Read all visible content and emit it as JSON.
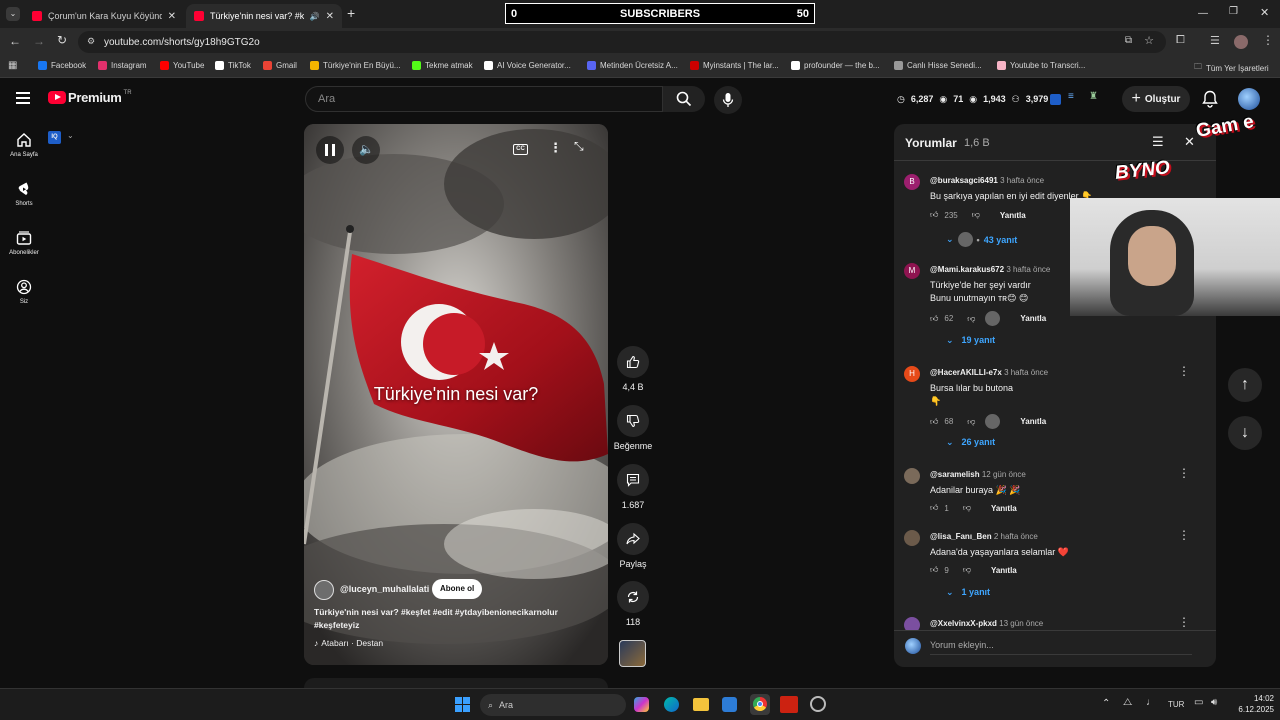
{
  "browser": {
    "tabs": [
      {
        "title": "Çorum'un Kara Kuyu Köyünde"
      },
      {
        "title": "Türkiye'nin nesi var? #keşfe"
      }
    ],
    "new_tab": "+",
    "url": "youtube.com/shorts/gy18h9GTG2o",
    "bookmarks": [
      {
        "label": "Facebook",
        "color": "#1877f2"
      },
      {
        "label": "Instagram",
        "color": "#e1306c"
      },
      {
        "label": "YouTube",
        "color": "#ff0000"
      },
      {
        "label": "TikTok",
        "color": "#ffffff"
      },
      {
        "label": "Gmail",
        "color": "#ea4335"
      },
      {
        "label": "Türkiye'nin En Büyü...",
        "color": "#f4b400"
      },
      {
        "label": "Tekme atmak",
        "color": "#53fc18"
      },
      {
        "label": "AI Voice Generator...",
        "color": "#ffffff"
      },
      {
        "label": "Metinden Ücretsiz A...",
        "color": "#5865f2"
      },
      {
        "label": "Myinstants | The lar...",
        "color": "#c00"
      },
      {
        "label": "profounder — the b...",
        "color": "#ffffff"
      },
      {
        "label": "Canlı Hisse Senedi...",
        "color": "#999"
      },
      {
        "label": "Youtube to Transcri...",
        "color": "#f7b4c6"
      }
    ],
    "all_bookmarks": "Tüm Yer İşaretleri"
  },
  "overlay": {
    "subscribers_label": "SUBSCRIBERS",
    "subscribers_left": "0",
    "subscribers_right": "50",
    "stream_logo": "BYNO",
    "stream_logo2": "Gam e"
  },
  "youtube": {
    "logo": "Premium",
    "logo_region": "TR",
    "search_placeholder": "Ara",
    "nav": [
      {
        "label": "Ana Sayfa",
        "icon": "home-icon"
      },
      {
        "label": "Shorts",
        "icon": "shorts-icon"
      },
      {
        "label": "Abonelikler",
        "icon": "subscriptions-icon"
      },
      {
        "label": "Siz",
        "icon": "account-icon"
      }
    ],
    "stats": [
      "6,287",
      "71",
      "1,943",
      "3,979"
    ],
    "create_label": "Oluştur",
    "short": {
      "overlay_title": "Türkiye'nin nesi var?",
      "channel": "@luceyn_muhallalati",
      "subscribe": "Abone ol",
      "description_line1": "Türkiye'nin nesi var? #keşfet #edit #ytdayibenionecikarnolur",
      "description_line2": "#keşfeteyiz",
      "sound": "Atabarı · Destan",
      "likes": "4,4 B",
      "dislike_label": "Beğenme",
      "comments_count": "1.687",
      "share_label": "Paylaş",
      "remix_count": "118"
    },
    "comments_panel": {
      "title": "Yorumlar",
      "count": "1,6 B",
      "input_placeholder": "Yorum ekleyin...",
      "reply_label": "Yanıtla",
      "items": [
        {
          "avatar_letter": "B",
          "avatar_color": "#9c1f6e",
          "user": "@buraksagci6491",
          "time": "3 hafta önce",
          "text": "Bu şarkıya yapılan en iyi edit diyenler 👇",
          "likes": "235",
          "replies": "43 yanıt"
        },
        {
          "avatar_letter": "M",
          "avatar_color": "#8e1450",
          "user": "@Mami.karakus672",
          "time": "3 hafta önce",
          "text": "Türkiye'de her şeyi vardır\nBunu unutmayın ᴛʀ😊 😊",
          "likes": "62",
          "replies": "19 yanıt"
        },
        {
          "avatar_letter": "H",
          "avatar_color": "#e64a19",
          "user": "@HacerAKILLI-e7x",
          "time": "3 hafta önce",
          "text": "Bursa lılar bu butona\n👇",
          "likes": "68",
          "replies": "26 yanıt"
        },
        {
          "avatar_letter": "",
          "avatar_color": "#7a6a5a",
          "user": "@saramelish",
          "time": "12 gün önce",
          "text": "Adanilar buraya 🎉 🎉",
          "likes": "1",
          "replies": ""
        },
        {
          "avatar_letter": "",
          "avatar_color": "#6b5a4a",
          "user": "@lisa_Fanı_Ben",
          "time": "2 hafta önce",
          "text": "Adana'da yaşayanlara selamlar ❤️",
          "likes": "9",
          "replies": "1 yanıt"
        },
        {
          "avatar_letter": "",
          "avatar_color": "#7b4fa0",
          "user": "@XxelvinxX-pkxd",
          "time": "13 gün önce",
          "text": "",
          "likes": "",
          "replies": ""
        }
      ]
    }
  },
  "taskbar": {
    "search": "Ara",
    "lang": "TUR",
    "time": "14:02",
    "date": "6.12.2025"
  }
}
